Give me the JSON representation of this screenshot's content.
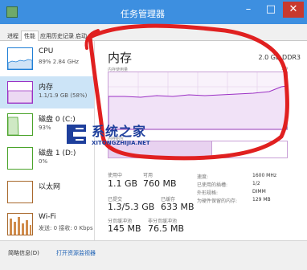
{
  "window": {
    "title": "任务管理器",
    "minimize": "–",
    "maximize": "□",
    "close": "✕"
  },
  "tabs": [
    {
      "label": "进程"
    },
    {
      "label": "性能"
    },
    {
      "label": "应用历史记录"
    },
    {
      "label": "启动"
    }
  ],
  "sidebar": {
    "items": [
      {
        "name": "CPU",
        "detail": "89% 2.84 GHz",
        "color": "#1f7fd6"
      },
      {
        "name": "内存",
        "detail": "1.1/1.9 GB (58%)",
        "color": "#9b30c4"
      },
      {
        "name": "磁盘 0 (C:)",
        "detail": "93%",
        "color": "#4aa32a"
      },
      {
        "name": "磁盘 1 (D:)",
        "detail": "0%",
        "color": "#4aa32a"
      },
      {
        "name": "以太网",
        "detail": "",
        "color": "#a8682c"
      },
      {
        "name": "Wi-Fi",
        "detail": "发送: 0 接收: 0 Kbps",
        "color": "#a8682c"
      }
    ]
  },
  "memory": {
    "title": "内存",
    "capacity": "2.0 GB DDR3",
    "usage_label": "内存使用量",
    "graph_max": "1.9",
    "graph_min": "0",
    "composition_label": "内存组合",
    "composition_in_use_fraction": 0.58,
    "in_use_label": "使用中",
    "in_use": "1.1 GB",
    "available_label": "可用",
    "available": "760 MB",
    "committed_label": "已提交",
    "committed": "1.3/5.3 GB",
    "cached_label": "已缓存",
    "cached": "633 MB",
    "paged_pool_label": "分页缓冲池",
    "paged_pool": "145 MB",
    "nonpaged_pool_label": "非分页缓冲池",
    "nonpaged_pool": "76.5 MB",
    "speed_label": "速度:",
    "speed": "1600 MHz",
    "slots_label": "已使用的插槽:",
    "slots": "1/2",
    "form_factor_label": "外形规格:",
    "form_factor": "DIMM",
    "reserved_label": "为硬件保留的内存:",
    "reserved": "129 MB"
  },
  "footer": {
    "less_details": "简略信息(D)",
    "open_resource_monitor": "打开资源监视器"
  },
  "watermark": {
    "name": "系统之家",
    "url": "XITONGZHIJIA.NET"
  }
}
